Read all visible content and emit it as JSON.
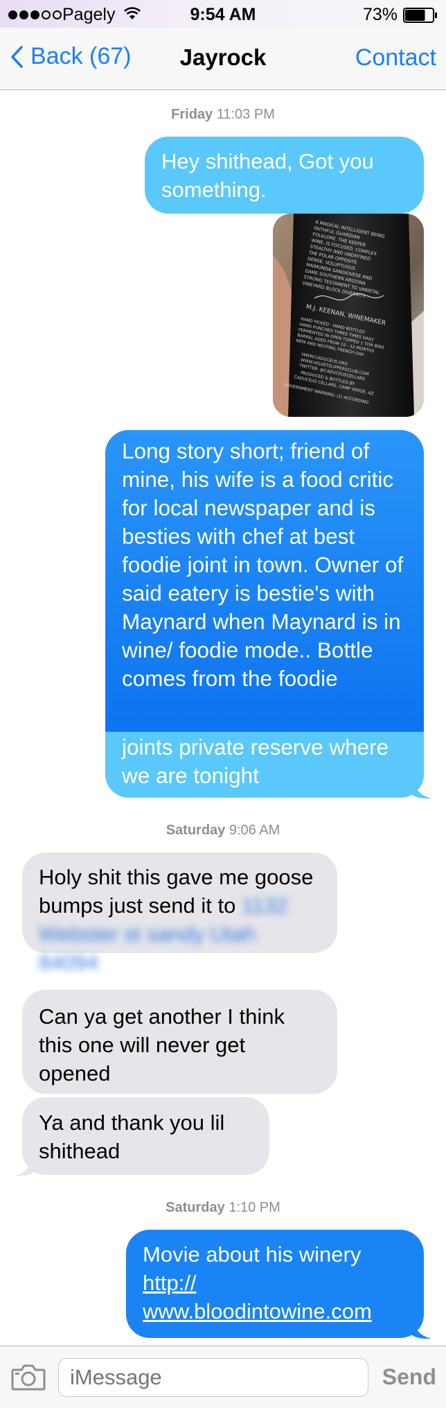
{
  "status_bar": {
    "carrier": "Pagely",
    "time": "9:54 AM",
    "battery": "73%",
    "battery_level": 0.73,
    "signal_bars_filled": 3,
    "signal_bars_total": 5
  },
  "nav": {
    "back_label": "Back (67)",
    "title": "Jayrock",
    "contact_label": "Contact"
  },
  "thread": {
    "ts1_day": "Friday",
    "ts1_time": "11:03 PM",
    "msg1": "Hey shithead, Got you something.",
    "bottle_label": {
      "l1": "A MAGICAL INTELLIGENT BEING",
      "l2": "FAITHFUL GUARDIAN",
      "l3": "FOLKLORE. THE KEEPER",
      "l4": "WINE, IS FOCUSED, COMPLEX",
      "l5": "STEALTHY AND UNDEFINED",
      "l6": "THE POLAR OPPOSITE",
      "l7": "DENSE, VOLUPTUOUS",
      "l8": "MAIMUNDA SANGIOVESE AND",
      "l9": "GAME SOUTHERN ARIZONA",
      "l10": "STRONG TESTAMENT TO VARIETAL",
      "l11": "VINEYARD BLOCK DIVERSITY.",
      "winemaker": "M.J. KEENAN, WINEMAKER",
      "b1": "HAND PICKED · HAND BOTTLED",
      "b2": "HAND PUNCHED THREE TIMES DAILY",
      "b3": "FERMENTED IN OPEN TOPPED 1 TON BINS",
      "b4": "BARREL AGED FROM 10 - 12 MONTHS",
      "b5": "NEW AND NEUTRAL FRENCH OAK",
      "w1": "WWW.CADUCEUS.ORG",
      "w2": "WWW.VELVETSLIPPERSCLUB.COM",
      "w3": "TWITTER: @CADUCEUSCELLARS",
      "p1": "PRODUCED & BOTTLED BY",
      "p2": "CADUCEUS CELLARS, CAMP VERDE, AZ",
      "gov": "GOVERNMENT WARNING: (1) ACCORDING"
    },
    "msg2_upper": "Long story short; friend of mine, his wife is a food critic for local newspaper and is besties with chef at best foodie joint in town. Owner of said eatery is bestie's with Maynard when Maynard is in wine/ foodie mode.. Bottle comes from the foodie",
    "msg2_lower": "joints private reserve where we are tonight",
    "ts2_day": "Saturday",
    "ts2_time": "9:06 AM",
    "msg3_text": "Holy shit this gave me goose bumps just send it to",
    "msg3_redacted": "1132 Webster st sandy Utah 84094",
    "msg4": "Can ya get another I think this one will never get opened",
    "msg5": "Ya and thank you lil shithead",
    "ts3_day": "Saturday",
    "ts3_time": "1:10 PM",
    "msg6_text": "Movie about his winery",
    "msg6_link1": "http://",
    "msg6_link2": "www.bloodintowine.com"
  },
  "input_bar": {
    "placeholder": "iMessage",
    "send_label": "Send"
  },
  "colors": {
    "accent": "#1c7ef7",
    "outgoing_light": "#5ac8fa",
    "outgoing_dark": "#1a84f5",
    "incoming": "#e5e5ea",
    "timestamp": "#8e8e93"
  },
  "icons": [
    "wifi-icon",
    "battery-icon",
    "back-chevron-icon",
    "camera-icon"
  ]
}
